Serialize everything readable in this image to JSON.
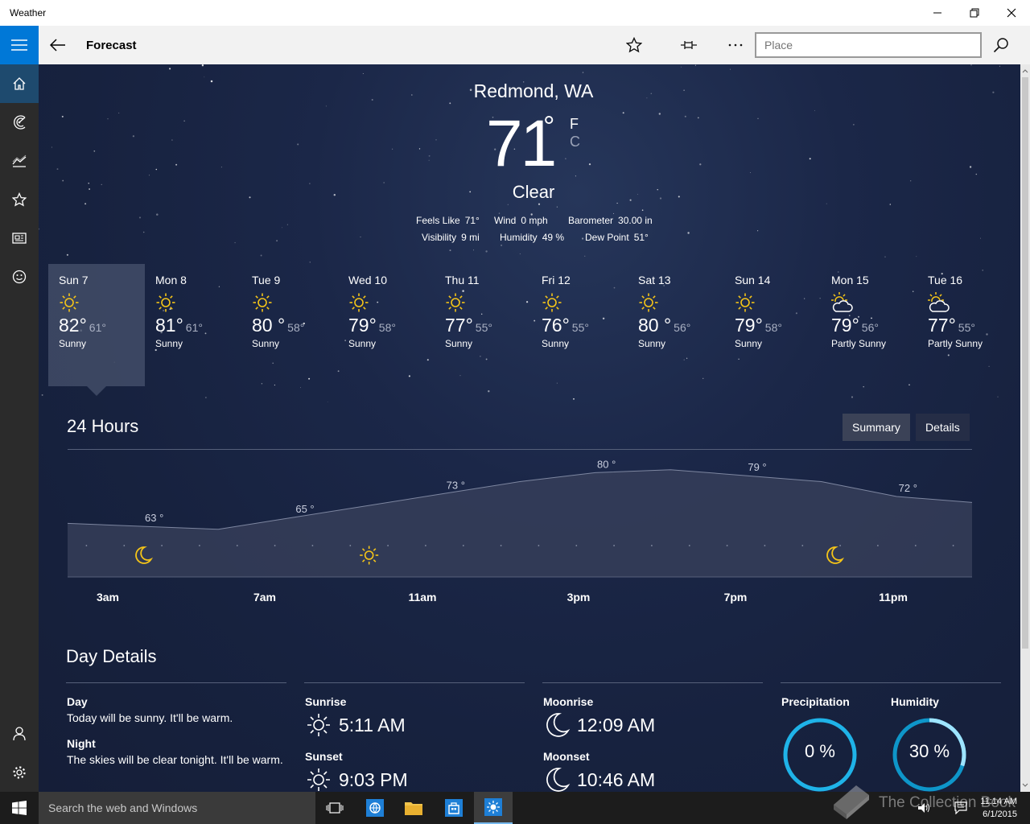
{
  "window": {
    "title": "Weather"
  },
  "appbar": {
    "title": "Forecast",
    "search_placeholder": "Place"
  },
  "current": {
    "location": "Redmond, WA",
    "temp": "71",
    "deg": "°",
    "unit_f": "F",
    "unit_c": "C",
    "condition": "Clear",
    "feels_like_label": "Feels Like",
    "feels_like": "71°",
    "wind_label": "Wind",
    "wind": "0 mph",
    "barometer_label": "Barometer",
    "barometer": "30.00 in",
    "visibility_label": "Visibility",
    "visibility": "9 mi",
    "humidity_label": "Humidity",
    "humidity": "49 %",
    "dew_label": "Dew Point",
    "dew": "51°"
  },
  "forecast": [
    {
      "day": "Sun 7",
      "hi": "82°",
      "lo": "61°",
      "cond": "Sunny",
      "icon": "sun-icon"
    },
    {
      "day": "Mon 8",
      "hi": "81°",
      "lo": "61°",
      "cond": "Sunny",
      "icon": "sun-icon"
    },
    {
      "day": "Tue 9",
      "hi": "80 °",
      "lo": "58°",
      "cond": "Sunny",
      "icon": "sun-icon"
    },
    {
      "day": "Wed 10",
      "hi": "79°",
      "lo": "58°",
      "cond": "Sunny",
      "icon": "sun-icon"
    },
    {
      "day": "Thu 11",
      "hi": "77°",
      "lo": "55°",
      "cond": "Sunny",
      "icon": "sun-icon"
    },
    {
      "day": "Fri 12",
      "hi": "76°",
      "lo": "55°",
      "cond": "Sunny",
      "icon": "sun-icon"
    },
    {
      "day": "Sat 13",
      "hi": "80 °",
      "lo": "56°",
      "cond": "Sunny",
      "icon": "sun-icon"
    },
    {
      "day": "Sun 14",
      "hi": "79°",
      "lo": "58°",
      "cond": "Sunny",
      "icon": "sun-icon"
    },
    {
      "day": "Mon 15",
      "hi": "79°",
      "lo": "56°",
      "cond": "Partly Sunny",
      "icon": "partly-sunny-icon"
    },
    {
      "day": "Tue 16",
      "hi": "77°",
      "lo": "55°",
      "cond": "Partly Sunny",
      "icon": "partly-sunny-icon"
    }
  ],
  "hours": {
    "title": "24 Hours",
    "summary_label": "Summary",
    "details_label": "Details",
    "x_labels": [
      "3am",
      "7am",
      "11am",
      "3pm",
      "7pm",
      "11pm"
    ]
  },
  "chart_data": {
    "type": "area",
    "title": "24 Hours",
    "x": [
      "1am",
      "3am",
      "5am",
      "7am",
      "9am",
      "11am",
      "1pm",
      "3pm",
      "5pm",
      "7pm",
      "9pm",
      "11pm",
      "1am"
    ],
    "values": [
      63,
      62,
      61,
      65,
      69,
      73,
      77,
      80,
      81,
      79,
      77,
      72,
      70
    ],
    "labels": [
      {
        "x": "3am",
        "text": "63 °"
      },
      {
        "x": "7am",
        "text": "65 °"
      },
      {
        "x": "11am",
        "text": "73 °"
      },
      {
        "x": "3pm",
        "text": "80 °"
      },
      {
        "x": "7pm",
        "text": "79 °"
      },
      {
        "x": "11pm",
        "text": "72 °"
      }
    ],
    "icons": [
      {
        "x": "3am",
        "icon": "moon-icon"
      },
      {
        "x": "9am",
        "icon": "sun-icon"
      },
      {
        "x": "1am+1",
        "icon": "moon-icon"
      }
    ],
    "xlabel": "",
    "ylabel": ""
  },
  "day_details": {
    "title": "Day Details",
    "day_label": "Day",
    "day_text": "Today will be sunny. It'll be warm.",
    "night_label": "Night",
    "night_text": "The skies will be clear tonight. It'll be warm.",
    "sunrise_label": "Sunrise",
    "sunrise": "5:11 AM",
    "sunset_label": "Sunset",
    "sunset": "9:03 PM",
    "moonrise_label": "Moonrise",
    "moonrise": "12:09 AM",
    "moonset_label": "Moonset",
    "moonset": "10:46 AM",
    "precip_label": "Precipitation",
    "precip": "0 %",
    "precip_fraction": 0,
    "humidity_label": "Humidity",
    "humidity": "30 %",
    "humidity_fraction": 0.3
  },
  "taskbar": {
    "search_text": "Search the web and Windows",
    "time": "11:14 AM",
    "date": "6/1/2015",
    "watermark": "The Collection Book"
  },
  "colors": {
    "accent": "#0078d7",
    "sun": "#f5c518",
    "ring": "#1fb3e8"
  }
}
